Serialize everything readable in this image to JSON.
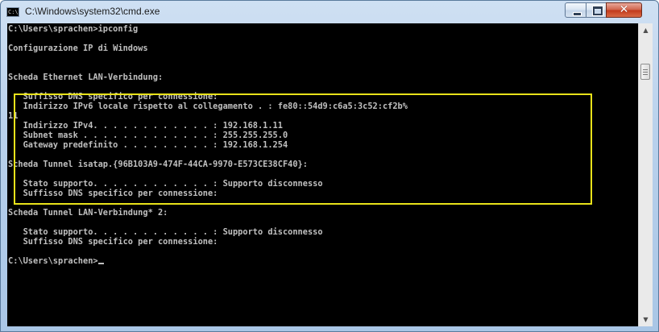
{
  "window": {
    "title": "C:\\Windows\\system32\\cmd.exe",
    "icon": "cmd-icon",
    "icon_text": "C:\\",
    "buttons": {
      "minimize": "minimize-icon",
      "maximize": "maximize-icon",
      "close": "close-icon",
      "close_glyph": "✕"
    }
  },
  "console": {
    "lines": [
      "C:\\Users\\sprachen>ipconfig",
      "",
      "Configurazione IP di Windows",
      "",
      "",
      "Scheda Ethernet LAN-Verbindung:",
      "",
      "   Suffisso DNS specifico per connessione:",
      "   Indirizzo IPv6 locale rispetto al collegamento . : fe80::54d9:c6a5:3c52:cf2b%",
      "11",
      "   Indirizzo IPv4. . . . . . . . . . . . : 192.168.1.11",
      "   Subnet mask . . . . . . . . . . . . . : 255.255.255.0",
      "   Gateway predefinito . . . . . . . . . : 192.168.1.254",
      "",
      "Scheda Tunnel isatap.{96B103A9-474F-44CA-9970-E573CE38CF40}:",
      "",
      "   Stato supporto. . . . . . . . . . . . : Supporto disconnesso",
      "   Suffisso DNS specifico per connessione:",
      "",
      "Scheda Tunnel LAN-Verbindung* 2:",
      "",
      "   Stato supporto. . . . . . . . . . . . : Supporto disconnesso",
      "   Suffisso DNS specifico per connessione:",
      "",
      "C:\\Users\\sprachen>"
    ],
    "text_color": "#c0c0c0",
    "background": "#000000",
    "highlight_color": "#e8e21a"
  },
  "scrollbar": {
    "up_glyph": "▲",
    "down_glyph": "▼"
  }
}
